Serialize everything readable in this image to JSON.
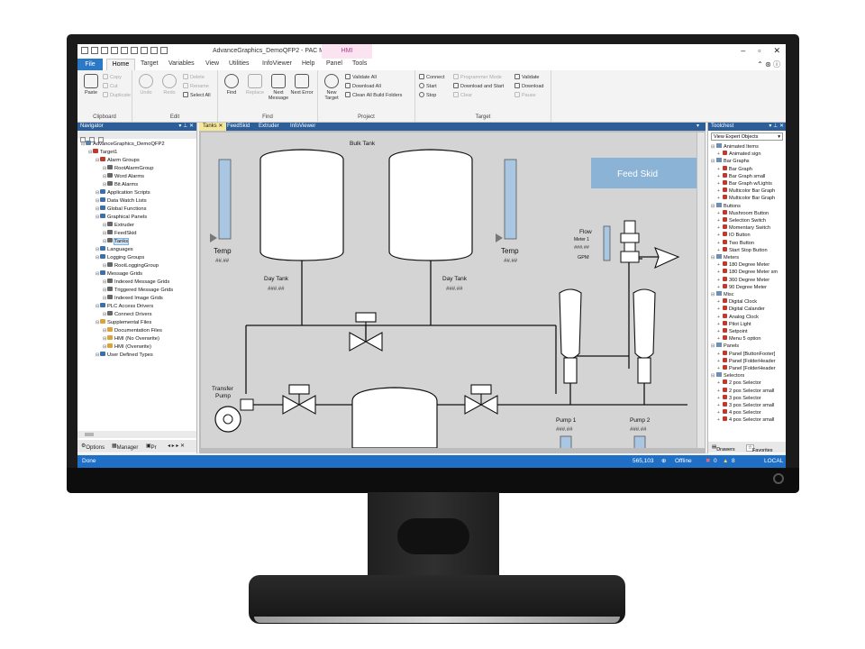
{
  "window": {
    "title": "AdvanceGraphics_DemoQFP2 - PAC Machine Edition",
    "context_tab": "HMI",
    "controls": [
      "–",
      "▫",
      "✕"
    ]
  },
  "menu": {
    "tabs": [
      "File",
      "Home",
      "Target",
      "Variables",
      "View",
      "Utilities",
      "InfoViewer",
      "Help",
      "Panel",
      "Tools"
    ]
  },
  "ribbon": {
    "clipboard": {
      "label": "Clipboard",
      "paste": "Paste",
      "copy": "Copy",
      "cut": "Cut",
      "duplicate": "Duplicate"
    },
    "edit": {
      "label": "Edit",
      "undo": "Undo",
      "redo": "Redo",
      "delete": "Delete",
      "rename": "Rename",
      "select_all": "Select All"
    },
    "find": {
      "label": "Find",
      "find": "Find",
      "replace": "Replace",
      "next_message": "Next Message",
      "next_error": "Next Error"
    },
    "project": {
      "label": "Project",
      "new_target": "New Target",
      "validate_all": "Validate All",
      "download_all": "Download All",
      "clean_all": "Clean All Build Folders"
    },
    "target": {
      "label": "Target",
      "connect": "Connect",
      "start": "Start",
      "stop": "Stop",
      "programmer_mode": "Programmer Mode",
      "download_and_start": "Download and Start",
      "clear": "Clear",
      "validate": "Validate",
      "download": "Download",
      "pause": "Pause"
    }
  },
  "navigator": {
    "title": "Navigator",
    "items": [
      {
        "label": "AdvanceGraphics_DemoQFP2",
        "level": 0,
        "color": "#5c7fa8"
      },
      {
        "label": "Target1",
        "level": 1,
        "color": "#c0392b"
      },
      {
        "label": "Alarm Groups",
        "level": 2,
        "color": "#c0392b"
      },
      {
        "label": "RootAlarmGroup",
        "level": 3,
        "color": "#666666"
      },
      {
        "label": "Word Alarms",
        "level": 3,
        "color": "#666666"
      },
      {
        "label": "Bit Alarms",
        "level": 3,
        "color": "#666666"
      },
      {
        "label": "Application Scripts",
        "level": 2,
        "color": "#3a6fb0"
      },
      {
        "label": "Data Watch Lists",
        "level": 2,
        "color": "#3a6fb0"
      },
      {
        "label": "Global Functions",
        "level": 2,
        "color": "#3a6fb0"
      },
      {
        "label": "Graphical Panels",
        "level": 2,
        "color": "#3a6fb0"
      },
      {
        "label": "Extruder",
        "level": 3,
        "color": "#666666"
      },
      {
        "label": "FeedSkid",
        "level": 3,
        "color": "#666666"
      },
      {
        "label": "Tanks",
        "level": 3,
        "color": "#666666"
      },
      {
        "label": "Languages",
        "level": 2,
        "color": "#3a6fb0"
      },
      {
        "label": "Logging Groups",
        "level": 2,
        "color": "#3a6fb0"
      },
      {
        "label": "RootLoggingGroup",
        "level": 3,
        "color": "#666666"
      },
      {
        "label": "Message Grids",
        "level": 2,
        "color": "#3a6fb0"
      },
      {
        "label": "Indexed Message Grids",
        "level": 3,
        "color": "#666666"
      },
      {
        "label": "Triggered Message Grids",
        "level": 3,
        "color": "#666666"
      },
      {
        "label": "Indexed Image Grids",
        "level": 3,
        "color": "#666666"
      },
      {
        "label": "PLC Access Drivers",
        "level": 2,
        "color": "#3a6fb0"
      },
      {
        "label": "Connect Drivers",
        "level": 3,
        "color": "#666666"
      },
      {
        "label": "Supplemental Files",
        "level": 2,
        "color": "#d9a43a"
      },
      {
        "label": "Documentation Files",
        "level": 3,
        "color": "#d9a43a"
      },
      {
        "label": "HMI (No Overwrite)",
        "level": 3,
        "color": "#d9a43a"
      },
      {
        "label": "HMI (Overwrite)",
        "level": 3,
        "color": "#d9a43a"
      },
      {
        "label": "User Defined Types",
        "level": 2,
        "color": "#3a6fb0"
      }
    ],
    "selected_index": 12,
    "bottom_tabs": [
      "Options",
      "Manager",
      "Pr"
    ]
  },
  "documents": {
    "tabs": [
      "Tanks",
      "FeedSkid",
      "Extruder",
      "InfoViewer"
    ],
    "active_tab": 0
  },
  "hmi_screen": {
    "bulk_tank_label": "Bulk Tank",
    "feed_skid_button": "Feed Skid",
    "temp_left_label": "Temp",
    "temp_left_value": "##.##",
    "temp_right_label": "Temp",
    "temp_right_value": "##.##",
    "day_tank_left_label": "Day Tank",
    "day_tank_left_value": "###.##",
    "day_tank_right_label": "Day Tank",
    "day_tank_right_value": "###.##",
    "flow_label": "Flow",
    "flow_meter_label": "Meter 1",
    "flow_value": "###.##",
    "flow_unit": "GPM",
    "transfer_pump_label_1": "Transfer",
    "transfer_pump_label_2": "Pump",
    "pump1_label": "Pump 1",
    "pump1_value": "###.##",
    "pump2_label": "Pump 2",
    "pump2_value": "###.##"
  },
  "toolchest": {
    "title": "Toolchest",
    "dropdown": "View Expert Objects",
    "items": [
      {
        "label": "Animated Items",
        "type": "folder"
      },
      {
        "label": "Animated sign",
        "type": "item"
      },
      {
        "label": "Bar Graphs",
        "type": "folder"
      },
      {
        "label": "Bar Graph",
        "type": "item"
      },
      {
        "label": "Bar Graph small",
        "type": "item"
      },
      {
        "label": "Bar Graph w/Lights",
        "type": "item"
      },
      {
        "label": "Multicolor Bar Graph",
        "type": "item"
      },
      {
        "label": "Multicolor Bar Graph",
        "type": "item"
      },
      {
        "label": "Buttons",
        "type": "folder"
      },
      {
        "label": "Mushroom Button",
        "type": "item"
      },
      {
        "label": "Selection Switch",
        "type": "item"
      },
      {
        "label": "Momentary Switch",
        "type": "item"
      },
      {
        "label": "IO Button",
        "type": "item"
      },
      {
        "label": "Two Button",
        "type": "item"
      },
      {
        "label": "Start Stop Button",
        "type": "item"
      },
      {
        "label": "Meters",
        "type": "folder"
      },
      {
        "label": "180 Degree Meter",
        "type": "item"
      },
      {
        "label": "180 Degree Meter sm",
        "type": "item"
      },
      {
        "label": "360 Degree Meter",
        "type": "item"
      },
      {
        "label": "90 Degree Meter",
        "type": "item"
      },
      {
        "label": "Misc",
        "type": "folder"
      },
      {
        "label": "Digital Clock",
        "type": "item"
      },
      {
        "label": "Digital Calander",
        "type": "item"
      },
      {
        "label": "Analog Clock",
        "type": "item"
      },
      {
        "label": "Pilot Light",
        "type": "item"
      },
      {
        "label": "Setpoint",
        "type": "item"
      },
      {
        "label": "Menu 5 option",
        "type": "item"
      },
      {
        "label": "Panels",
        "type": "folder"
      },
      {
        "label": "Panel [ButtonFooter]",
        "type": "item"
      },
      {
        "label": "Panel [FolderHeader",
        "type": "item"
      },
      {
        "label": "Panel [FolderHeader",
        "type": "item"
      },
      {
        "label": "Selectors",
        "type": "folder"
      },
      {
        "label": "2 pos Selector",
        "type": "item"
      },
      {
        "label": "2 pos Selector small",
        "type": "item"
      },
      {
        "label": "3 pos Selector",
        "type": "item"
      },
      {
        "label": "3 pos Selector small",
        "type": "item"
      },
      {
        "label": "4 pos Selector",
        "type": "item"
      },
      {
        "label": "4 pos Selector small",
        "type": "item"
      }
    ],
    "bottom_tabs": [
      "Drawers",
      "Favorites"
    ]
  },
  "status": {
    "left": "Done",
    "coords": "565,103",
    "mode": "Offline",
    "errors": "0",
    "warnings": "8",
    "location": "LOCAL"
  },
  "colors": {
    "accent_blue": "#2c5f99",
    "status_blue": "#1f6fc7",
    "feed_skid": "#8ab3d6",
    "hmi_background": "#d4d4d4"
  }
}
